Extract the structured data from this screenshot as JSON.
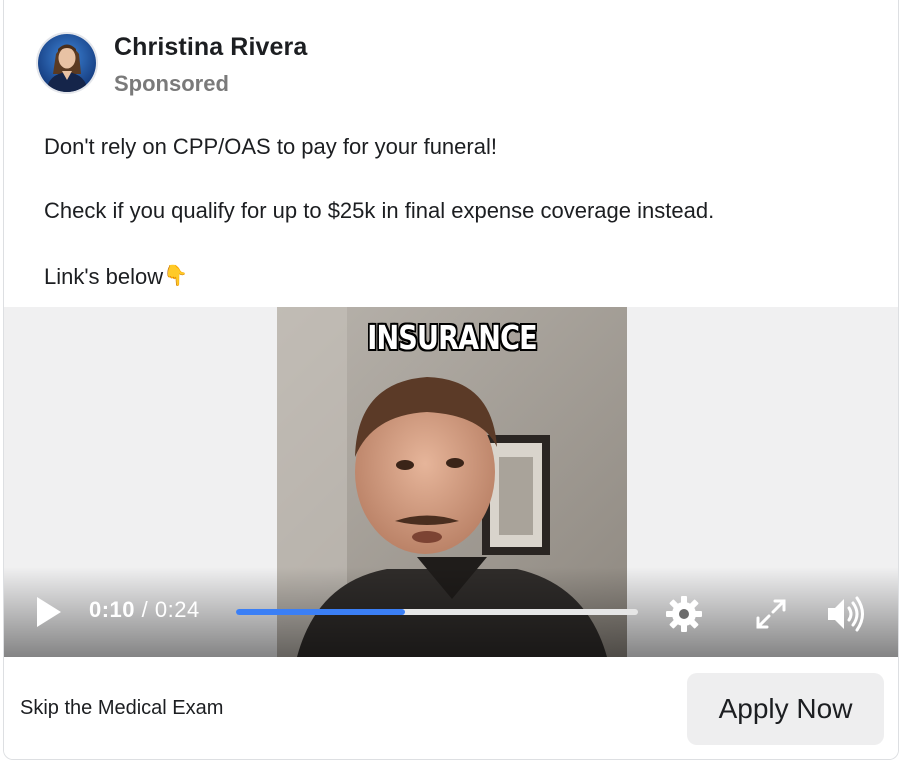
{
  "post": {
    "author": "Christina Rivera",
    "label": "Sponsored",
    "text_lines": [
      "Don't rely on CPP/OAS to pay for your funeral!",
      "Check if you qualify for up to $25k in final expense coverage instead.",
      "Link's below"
    ],
    "emoji": "👇"
  },
  "video": {
    "overlay_caption": "INSURANCE",
    "current_time": "0:10",
    "separator": "/",
    "total_time": "0:24",
    "progress_fraction": 0.42,
    "icons": {
      "play": "play-icon",
      "settings": "gear-icon",
      "fullscreen": "fullscreen-icon",
      "volume": "volume-icon"
    }
  },
  "cta": {
    "caption": "Skip the Medical Exam",
    "button_label": "Apply Now"
  },
  "colors": {
    "progress_fill": "#3b7ff5",
    "progress_track": "#e6e6e6",
    "sponsored_text": "#7a7a7a",
    "cta_button_bg": "#eeeeef"
  }
}
